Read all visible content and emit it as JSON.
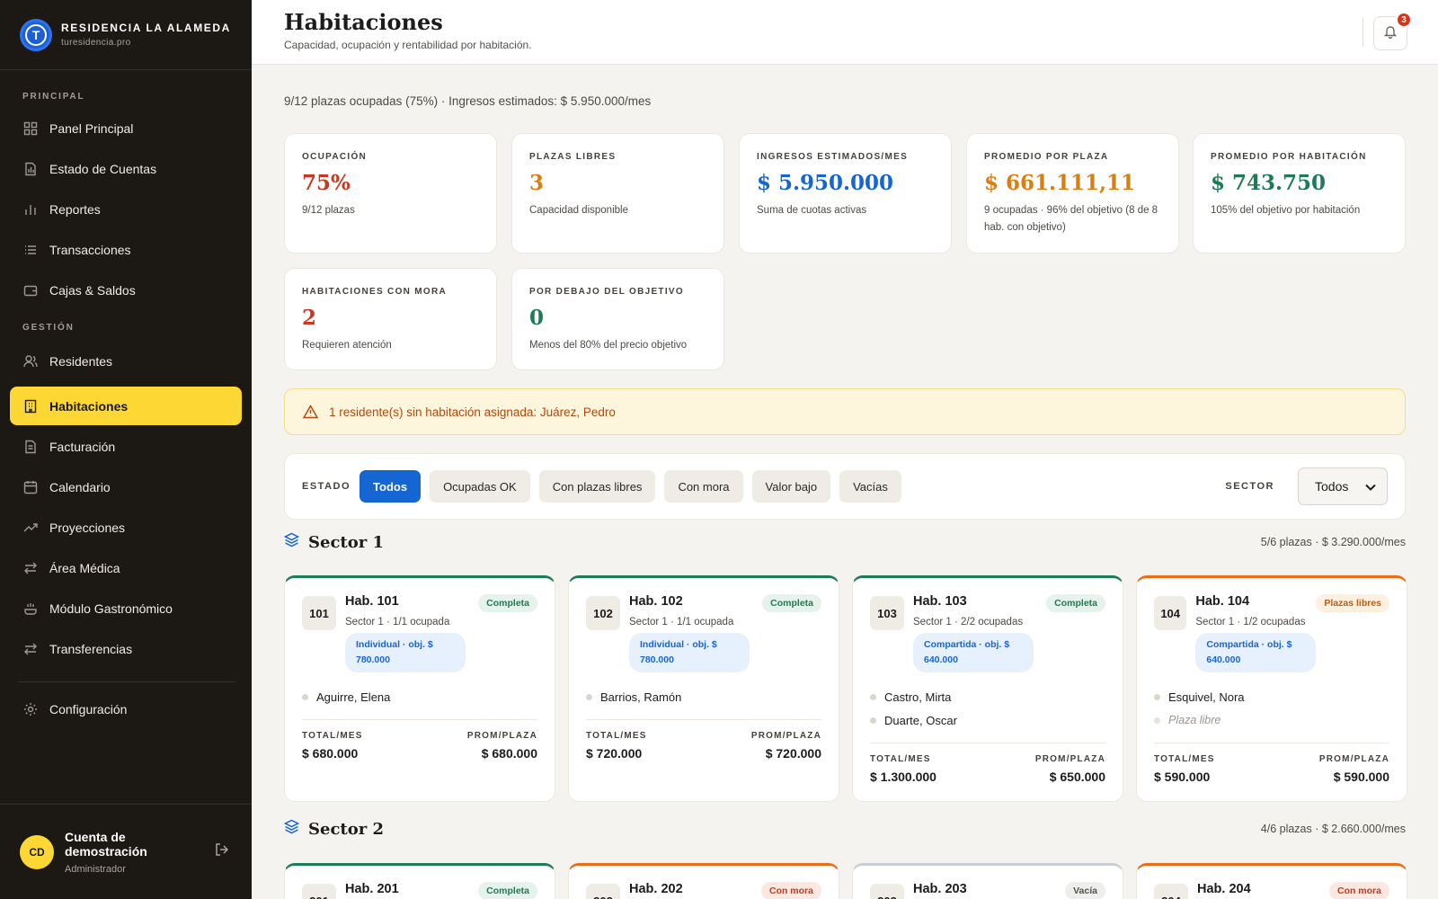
{
  "brand": {
    "title": "RESIDENCIA LA ALAMEDA",
    "subtitle": "turesidencia.pro"
  },
  "sidebar": {
    "section_principal": "PRINCIPAL",
    "section_gestion": "GESTIÓN",
    "items": [
      {
        "label": "Panel Principal",
        "icon": "dashboard-icon"
      },
      {
        "label": "Estado de Cuentas",
        "icon": "document-icon"
      },
      {
        "label": "Reportes",
        "icon": "bar-chart-icon"
      },
      {
        "label": "Transacciones",
        "icon": "list-icon"
      },
      {
        "label": "Cajas & Saldos",
        "icon": "wallet-icon"
      },
      {
        "label": "Residentes",
        "icon": "users-icon"
      },
      {
        "label": "Habitaciones",
        "icon": "building-icon",
        "active": true
      },
      {
        "label": "Facturación",
        "icon": "invoice-icon"
      },
      {
        "label": "Calendario",
        "icon": "calendar-icon"
      },
      {
        "label": "Proyecciones",
        "icon": "trend-icon"
      },
      {
        "label": "Área Médica",
        "icon": "arrows-icon"
      },
      {
        "label": "Módulo Gastronómico",
        "icon": "food-icon"
      },
      {
        "label": "Transferencias",
        "icon": "transfer-icon"
      },
      {
        "label": "Configuración",
        "icon": "gear-icon"
      }
    ]
  },
  "user": {
    "initials": "CD",
    "name": "Cuenta de demostración",
    "role": "Administrador"
  },
  "header": {
    "title": "Habitaciones",
    "subtitle": "Capacidad, ocupación y rentabilidad por habitación.",
    "notifications": "3"
  },
  "summary": "9/12 plazas ocupadas (75%) · Ingresos estimados: $ 5.950.000/mes",
  "kpis": [
    {
      "label": "OCUPACIÓN",
      "value": "75%",
      "desc": "9/12 plazas",
      "color": "#c9381e"
    },
    {
      "label": "PLAZAS LIBRES",
      "value": "3",
      "desc": "Capacidad disponible",
      "color": "#dd7d10"
    },
    {
      "label": "INGRESOS ESTIMADOS/MES",
      "value": "$ 5.950.000",
      "desc": "Suma de cuotas activas",
      "color": "#1566d3"
    },
    {
      "label": "PROMEDIO POR PLAZA",
      "value": "$ 661.111,11",
      "desc": "9 ocupadas · 96% del objetivo (8 de 8 hab. con objetivo)",
      "color": "#dd7d10"
    },
    {
      "label": "PROMEDIO POR HABITACIÓN",
      "value": "$ 743.750",
      "desc": "105% del objetivo por habitación",
      "color": "#1d7b55"
    },
    {
      "label": "HABITACIONES CON MORA",
      "value": "2",
      "desc": "Requieren atención",
      "color": "#c9381e"
    },
    {
      "label": "POR DEBAJO DEL OBJETIVO",
      "value": "0",
      "desc": "Menos del 80% del precio objetivo",
      "color": "#1d7b55"
    }
  ],
  "alert": "1 residente(s) sin habitación asignada: Juárez, Pedro",
  "filters": {
    "estado_label": "ESTADO",
    "chips": [
      "Todos",
      "Ocupadas OK",
      "Con plazas libres",
      "Con mora",
      "Valor bajo",
      "Vacías"
    ],
    "active": "Todos",
    "sector_label": "SECTOR",
    "sector_value": "Todos"
  },
  "sectors": [
    {
      "title": "Sector 1",
      "meta": "5/6 plazas · $ 3.290.000/mes",
      "rooms": [
        {
          "num": "101",
          "name": "Hab. 101",
          "status": "Completa",
          "sub": "Sector 1 · 1/1 ocupada",
          "type": "Individual · obj. $ 780.000",
          "residents": [
            "Aguirre, Elena"
          ],
          "free": [],
          "total_label": "TOTAL/MES",
          "total": "$ 680.000",
          "avg_label": "PROM/PLAZA",
          "avg": "$ 680.000"
        },
        {
          "num": "102",
          "name": "Hab. 102",
          "status": "Completa",
          "sub": "Sector 1 · 1/1 ocupada",
          "type": "Individual · obj. $ 780.000",
          "residents": [
            "Barrios, Ramón"
          ],
          "free": [],
          "total_label": "TOTAL/MES",
          "total": "$ 720.000",
          "avg_label": "PROM/PLAZA",
          "avg": "$ 720.000"
        },
        {
          "num": "103",
          "name": "Hab. 103",
          "status": "Completa",
          "sub": "Sector 1 · 2/2 ocupadas",
          "type": "Compartida · obj. $ 640.000",
          "residents": [
            "Castro, Mirta",
            "Duarte, Oscar"
          ],
          "free": [],
          "total_label": "TOTAL/MES",
          "total": "$ 1.300.000",
          "avg_label": "PROM/PLAZA",
          "avg": "$ 650.000"
        },
        {
          "num": "104",
          "name": "Hab. 104",
          "status": "Plazas libres",
          "sub": "Sector 1 · 1/2 ocupadas",
          "type": "Compartida · obj. $ 640.000",
          "residents": [
            "Esquivel, Nora"
          ],
          "free": [
            "Plaza libre"
          ],
          "total_label": "TOTAL/MES",
          "total": "$ 590.000",
          "avg_label": "PROM/PLAZA",
          "avg": "$ 590.000"
        }
      ]
    },
    {
      "title": "Sector 2",
      "meta": "4/6 plazas · $ 2.660.000/mes",
      "rooms": [
        {
          "num": "201",
          "name": "Hab. 201",
          "status": "Completa"
        },
        {
          "num": "202",
          "name": "Hab. 202",
          "status": "Con mora"
        },
        {
          "num": "203",
          "name": "Hab. 203",
          "status": "Vacía"
        },
        {
          "num": "204",
          "name": "Hab. 204",
          "status": "Con mora"
        }
      ]
    }
  ]
}
